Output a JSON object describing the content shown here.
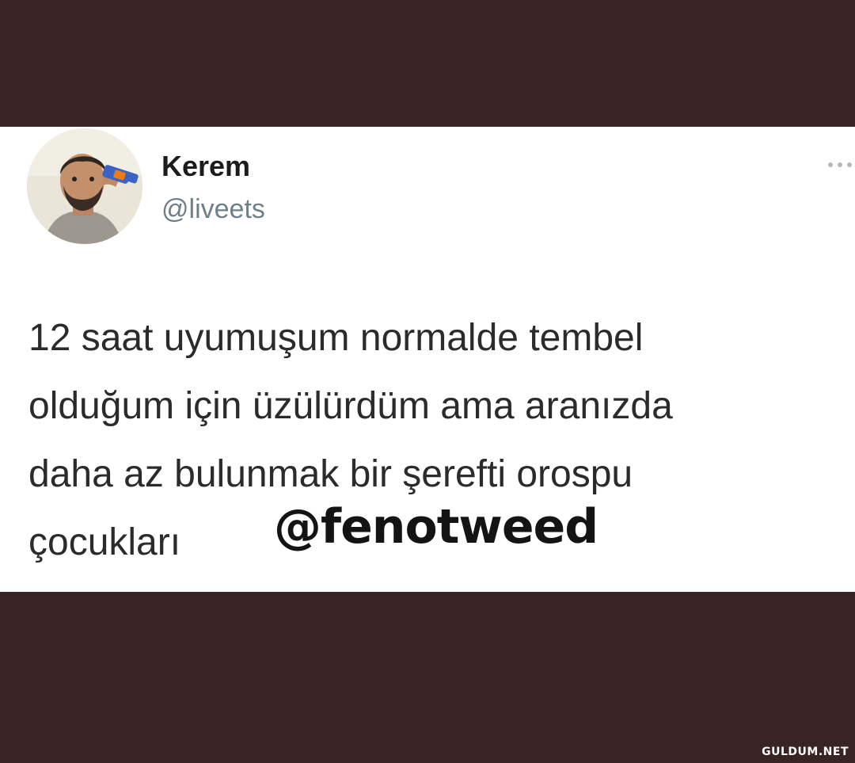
{
  "tweet": {
    "display_name": "Kerem",
    "handle": "@liveets",
    "text_lines": [
      "12 saat uyumuşum normalde tembel",
      "olduğum için üzülürdüm ama aranızda",
      "daha az bulunmak bir şerefti orospu",
      "çocukları"
    ],
    "more_icon": "more-dots-icon",
    "avatar": "profile-photo"
  },
  "overlay": {
    "account_tag": "@fenotweed"
  },
  "footer": {
    "site_watermark": "GULDUM.NET"
  },
  "colors": {
    "frame_background": "#382424",
    "card_background": "#ffffff",
    "name_text": "#1c1c1c",
    "handle_text": "#6e7f8c",
    "body_text": "#2b2b2b"
  }
}
